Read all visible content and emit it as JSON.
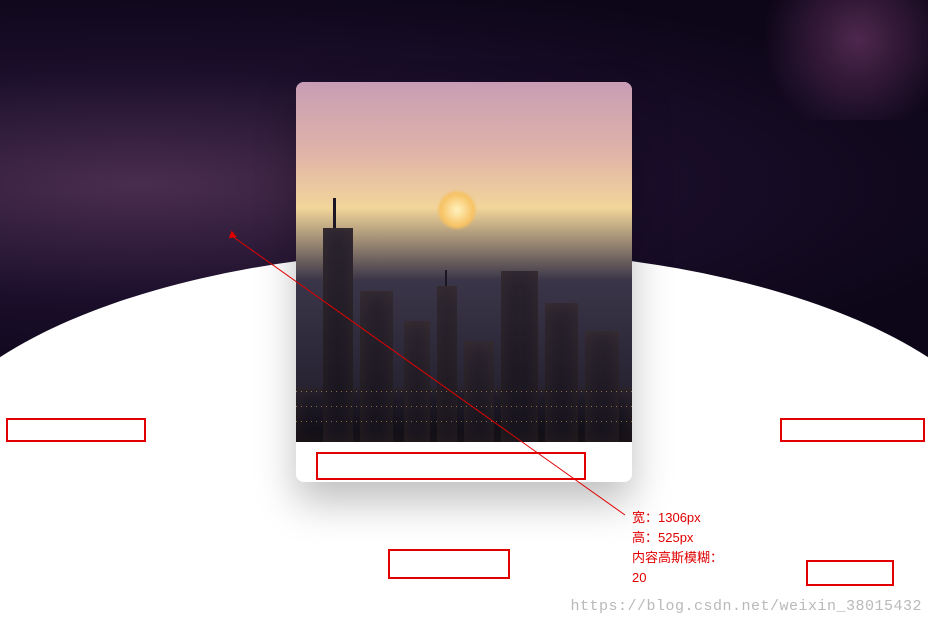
{
  "annotation": {
    "width_label": "宽：",
    "width_value": "1306px",
    "height_label": "高：",
    "height_value": "525px",
    "blur_label": "内容高斯模糊：",
    "blur_value": "20"
  },
  "watermark": "https://blog.csdn.net/weixin_38015432",
  "colors": {
    "annotation_red": "#e00000"
  }
}
